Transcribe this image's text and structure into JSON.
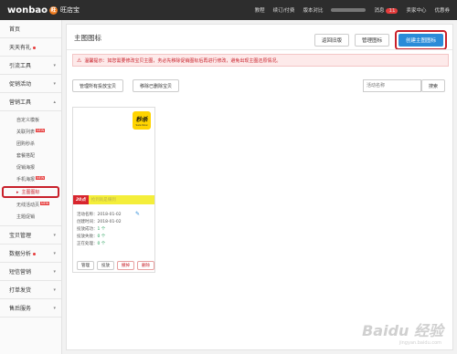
{
  "topbar": {
    "logo": {
      "text_pre": "wonbao",
      "mark": "旺",
      "text_post": "旺店宝"
    },
    "nav": [
      "教程",
      "续订/付费",
      "版本对比",
      "消息",
      "卖家中心",
      "优惠券"
    ],
    "message_count": "11"
  },
  "sidebar": {
    "items_top": [
      {
        "label": "首页",
        "arrow": false,
        "dot": false
      },
      {
        "label": "天天有礼",
        "arrow": false,
        "dot": true
      },
      {
        "label": "引流工具",
        "arrow": true,
        "dot": false
      },
      {
        "label": "促销活动",
        "arrow": true,
        "dot": false
      },
      {
        "label": "营销工具",
        "arrow": true,
        "dot": false
      }
    ],
    "sub_items": [
      {
        "label": "自定义模板",
        "new": false
      },
      {
        "label": "关联列表",
        "new": true
      },
      {
        "label": "团购秒杀",
        "new": false
      },
      {
        "label": "套餐搭配",
        "new": false
      },
      {
        "label": "促销海报",
        "new": false
      },
      {
        "label": "手机海报",
        "new": true
      },
      {
        "label": "主图图标",
        "new": false,
        "active": true
      },
      {
        "label": "无线活动页",
        "new": true
      },
      {
        "label": "主题促销",
        "new": false
      }
    ],
    "items_bottom": [
      {
        "label": "宝贝管理",
        "arrow": true,
        "dot": false
      },
      {
        "label": "数据分析",
        "arrow": true,
        "dot": true
      },
      {
        "label": "短信营销",
        "arrow": true,
        "dot": false
      },
      {
        "label": "打单发货",
        "arrow": true,
        "dot": false
      },
      {
        "label": "售后服务",
        "arrow": true,
        "dot": false
      }
    ]
  },
  "main": {
    "title": "主图图标",
    "buttons": {
      "return_list": "返回旧版",
      "manage_icons": "管理图标",
      "create_icon": "创建主图图标"
    },
    "alert": "温馨提示：如您需要修改宝贝主图，务必先移除促销图标后再进行修改，避免出现主图还原情况。",
    "toolbar": {
      "manage_all": "管理所有投放宝贝",
      "remove_deleted": "移除已删除宝贝",
      "search_placeholder": "活动名称",
      "search_button": "搜索"
    },
    "card": {
      "badge_main": "秒杀",
      "badge_sub": "Sale Now",
      "banner_red": "20点",
      "banner_text": "抢到就是赚到",
      "name_label": "活动名称：",
      "name_value": "2018-01-02",
      "created_label": "创建时间：",
      "created_value": "2018-01-02",
      "deploy_ok_label": "投放成功：",
      "deploy_ok_value": "1 个",
      "deploy_fail_label": "投放失败：",
      "deploy_fail_value": "0 个",
      "processing_label": "正在处理：",
      "processing_value": "0 个",
      "btn_manage": "管理",
      "btn_deploy": "投放",
      "btn_remove": "撤掉",
      "btn_delete": "删除"
    }
  },
  "watermark": {
    "main": "Baidu 经验",
    "sub": "jingyan.baidu.com"
  },
  "colors": {
    "accent": "#2a8bd8",
    "highlight": "#c8202a",
    "badge_yellow": "#ffd400"
  }
}
